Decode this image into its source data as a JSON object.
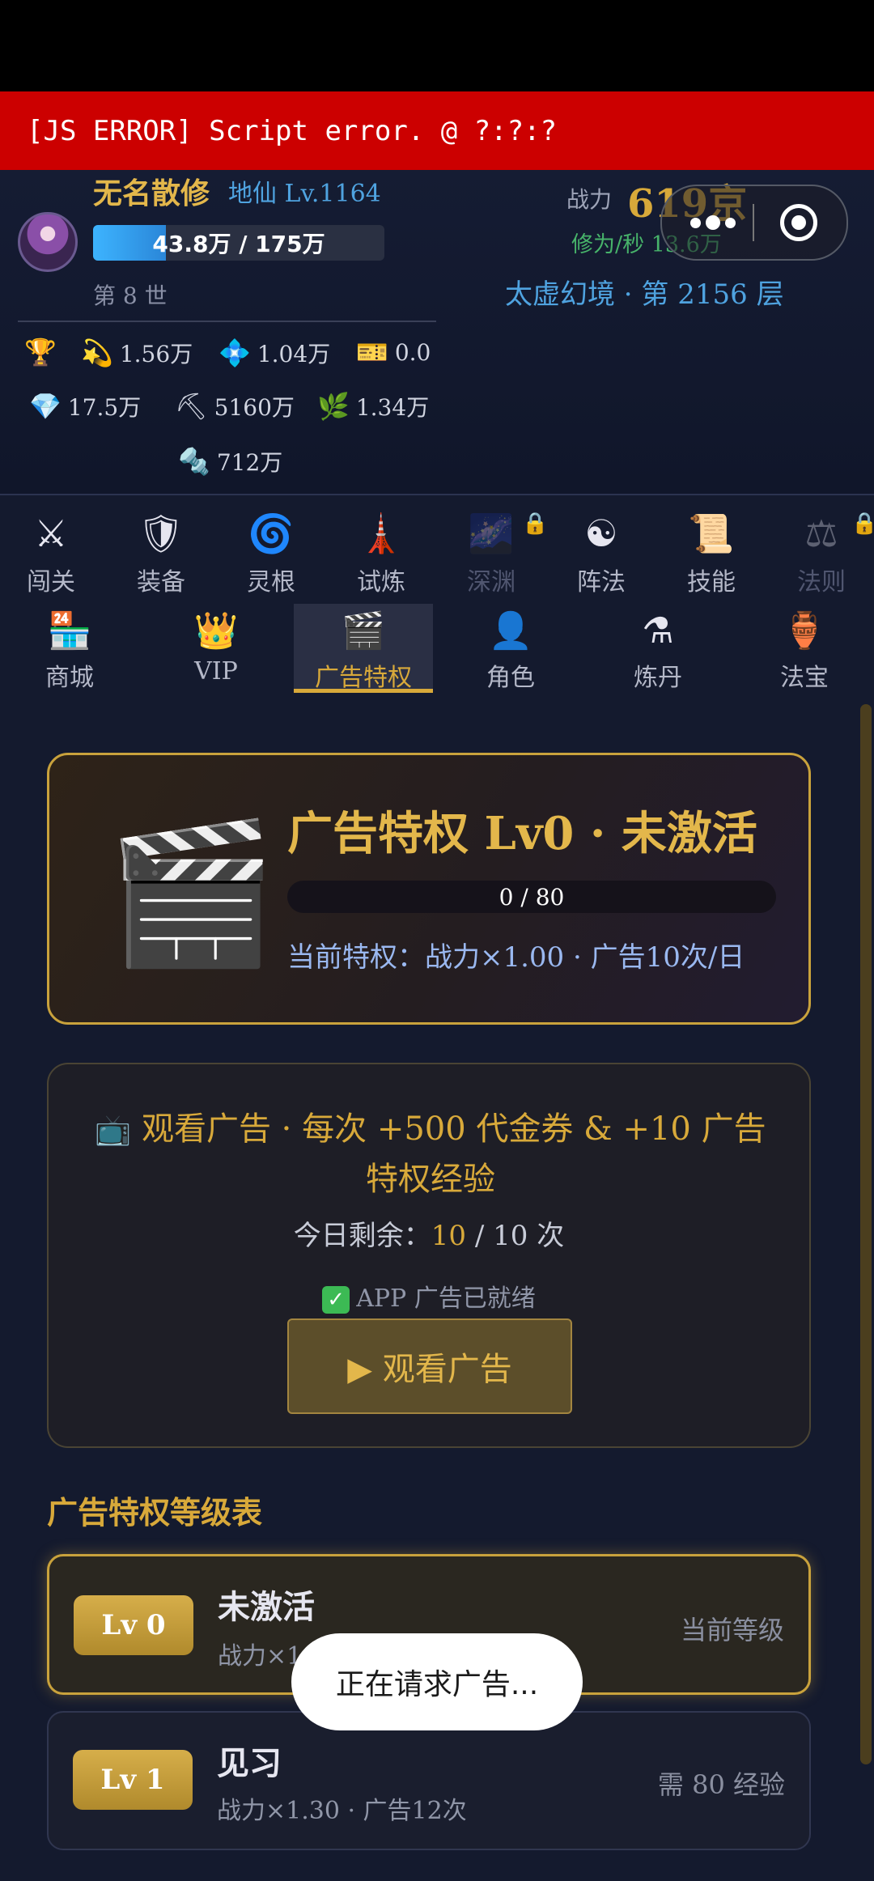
{
  "error_bar": {
    "text": "[JS ERROR] Script error. @ ?:?:?"
  },
  "player": {
    "name": "无名散修",
    "realm": "地仙",
    "level": "Lv.1164",
    "xp_text": "43.8万 / 175万",
    "xp_fraction": 0.25,
    "generation": "第 8 世"
  },
  "stats": {
    "power_label": "战力",
    "power_value": "619京",
    "rate": "修为/秒 13.6万",
    "floor": "太虚幻境 · 第 2156 层"
  },
  "resources": [
    {
      "icon": "trophy-icon",
      "glyph": "🏆",
      "value": ""
    },
    {
      "icon": "comet-icon",
      "glyph": "💫",
      "value": "1.56万"
    },
    {
      "icon": "crystal-icon",
      "glyph": "💠",
      "value": "1.04万"
    },
    {
      "icon": "ticket-icon",
      "glyph": "🎫",
      "value": "0.0"
    },
    {
      "icon": "diamond-icon",
      "glyph": "💎",
      "value": "17.5万"
    },
    {
      "icon": "pickaxe-icon",
      "glyph": "⛏",
      "value": "5160万"
    },
    {
      "icon": "herb-icon",
      "glyph": "🌿",
      "value": "1.34万"
    },
    {
      "icon": "bolt-icon",
      "glyph": "🔩",
      "value": "712万"
    }
  ],
  "nav_row1": [
    {
      "label": "闯关",
      "icon": "crossed-swords-icon",
      "glyph": "⚔",
      "locked": false
    },
    {
      "label": "装备",
      "icon": "shield-icon",
      "glyph": "🛡",
      "locked": false
    },
    {
      "label": "灵根",
      "icon": "spiral-icon",
      "glyph": "🌀",
      "locked": false
    },
    {
      "label": "试炼",
      "icon": "tower-icon",
      "glyph": "🗼",
      "locked": false
    },
    {
      "label": "深渊",
      "icon": "abyss-icon",
      "glyph": "🌌",
      "locked": true
    },
    {
      "label": "阵法",
      "icon": "yin-yang-icon",
      "glyph": "☯",
      "locked": false
    },
    {
      "label": "技能",
      "icon": "scroll-icon",
      "glyph": "📜",
      "locked": false
    },
    {
      "label": "法则",
      "icon": "scales-icon",
      "glyph": "⚖",
      "locked": true
    }
  ],
  "nav_row2": [
    {
      "label": "商城",
      "icon": "store-icon",
      "glyph": "🏪"
    },
    {
      "label": "VIP",
      "icon": "crown-icon",
      "glyph": "👑"
    },
    {
      "label": "广告特权",
      "icon": "clapper-icon",
      "glyph": "🎬",
      "active": true
    },
    {
      "label": "角色",
      "icon": "person-icon",
      "glyph": "👤"
    },
    {
      "label": "炼丹",
      "icon": "flask-icon",
      "glyph": "⚗"
    },
    {
      "label": "法宝",
      "icon": "vase-icon",
      "glyph": "🏺"
    }
  ],
  "privilege_card": {
    "icon": "clapper-icon",
    "title": "广告特权 Lv0 · 未激活",
    "progress_text": "0 / 80",
    "progress_fraction": 0,
    "current": "当前特权：战力×1.00 · 广告10次/日"
  },
  "watch_card": {
    "title": "观看广告 · 每次 +500 代金券 & +10 广告特权经验",
    "remaining_label": "今日剩余：",
    "remaining_used": "10",
    "remaining_total": " / 10 次",
    "ready_text": "APP 广告已就绪",
    "button_label": "▶ 观看广告"
  },
  "level_table": {
    "title": "广告特权等级表",
    "rows": [
      {
        "badge": "Lv 0",
        "name": "未激活",
        "desc": "战力×1.00 · 广告10次",
        "right": "当前等级",
        "current": true
      },
      {
        "badge": "Lv 1",
        "name": "见习",
        "desc": "战力×1.30 · 广告12次",
        "right": "需 80 经验",
        "current": false
      }
    ]
  },
  "toast": {
    "text": "正在请求广告..."
  }
}
